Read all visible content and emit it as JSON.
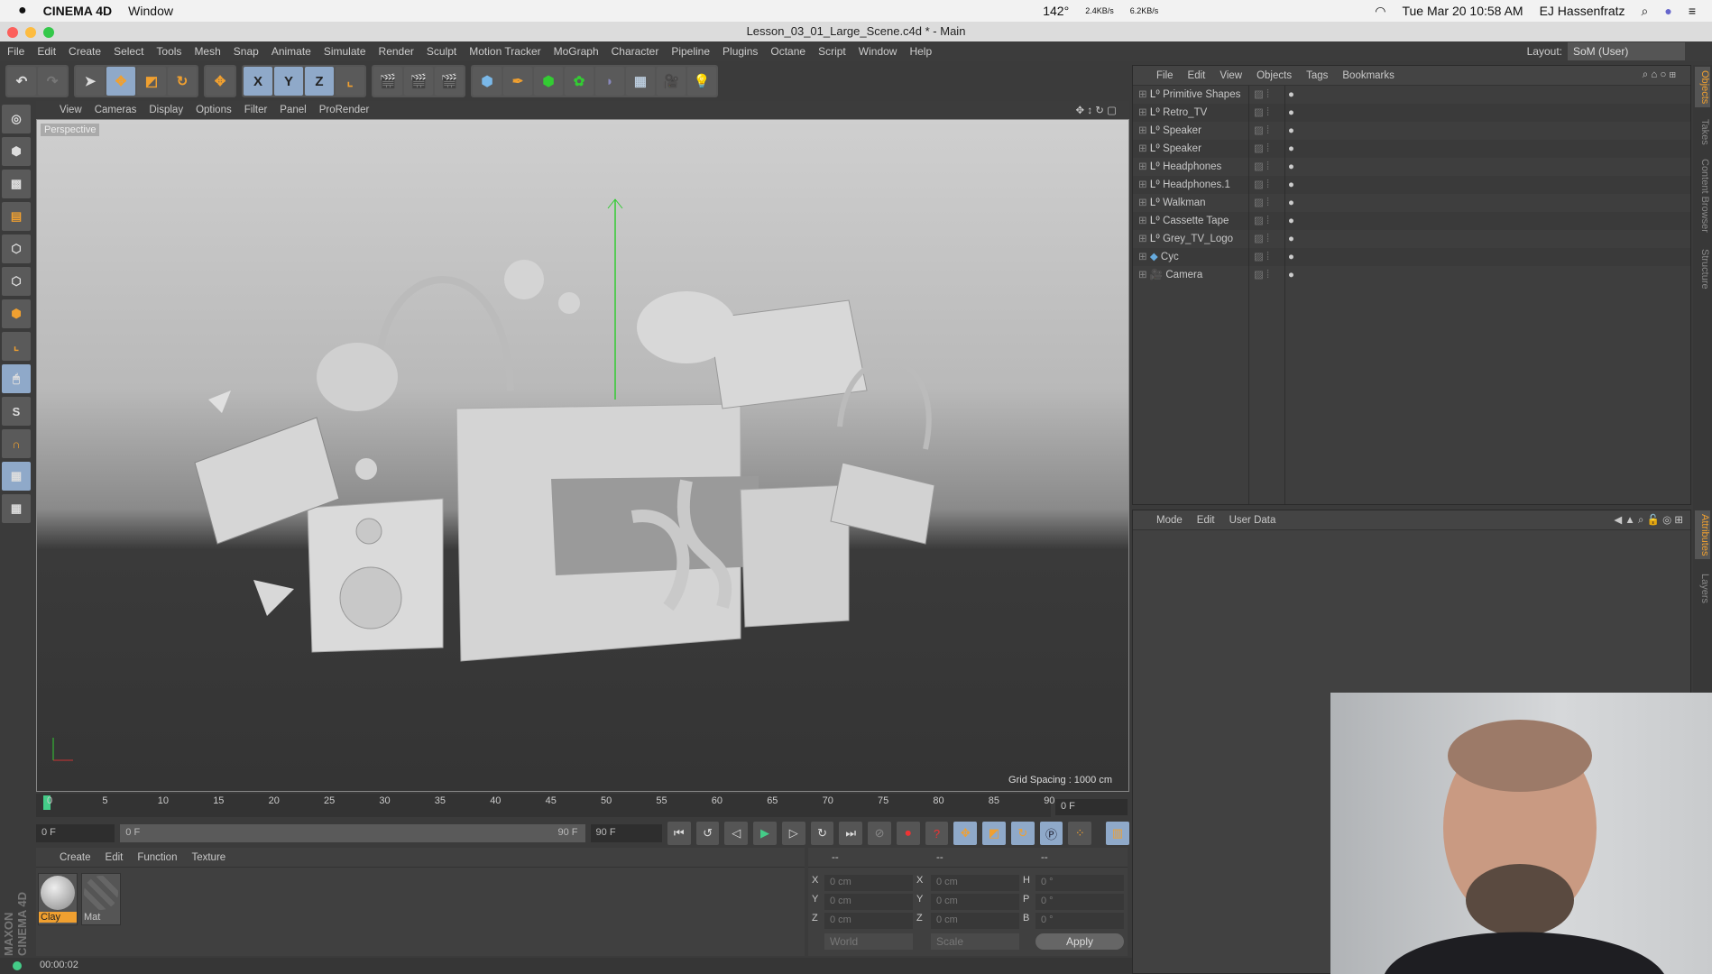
{
  "mac_menubar": {
    "app": "CINEMA 4D",
    "menu": "Window",
    "temp": "142°",
    "net_up": "2.4KB/s",
    "net_down": "6.2KB/s",
    "datetime": "Tue Mar 20  10:58 AM",
    "user": "EJ Hassenfratz"
  },
  "window": {
    "title": "Lesson_03_01_Large_Scene.c4d * - Main"
  },
  "menu": [
    "File",
    "Edit",
    "Create",
    "Select",
    "Tools",
    "Mesh",
    "Snap",
    "Animate",
    "Simulate",
    "Render",
    "Sculpt",
    "Motion Tracker",
    "MoGraph",
    "Character",
    "Pipeline",
    "Plugins",
    "Octane",
    "Script",
    "Window",
    "Help"
  ],
  "layout": {
    "label": "Layout:",
    "value": "SoM (User)"
  },
  "toolbar": {
    "x": "X",
    "y": "Y",
    "z": "Z"
  },
  "viewport": {
    "menu": [
      "View",
      "Cameras",
      "Display",
      "Options",
      "Filter",
      "Panel",
      "ProRender"
    ],
    "label": "Perspective",
    "grid_spacing": "Grid Spacing : 1000 cm"
  },
  "timeline": {
    "ticks": [
      "0",
      "5",
      "10",
      "15",
      "20",
      "25",
      "30",
      "35",
      "40",
      "45",
      "50",
      "55",
      "60",
      "65",
      "70",
      "75",
      "80",
      "85",
      "90"
    ],
    "current_frame": "0 F",
    "start": "0 F",
    "range_start": "0 F",
    "range_end": "90 F",
    "end": "90 F"
  },
  "material_manager": {
    "menu": [
      "Create",
      "Edit",
      "Function",
      "Texture"
    ],
    "materials": [
      {
        "name": "Clay",
        "selected": true
      },
      {
        "name": "Mat",
        "selected": false
      }
    ]
  },
  "coordinates": {
    "headers": [
      "--",
      "--",
      "--"
    ],
    "rows": [
      {
        "a": "X",
        "av": "0 cm",
        "b": "X",
        "bv": "0 cm",
        "c": "H",
        "cv": "0 °"
      },
      {
        "a": "Y",
        "av": "0 cm",
        "b": "Y",
        "bv": "0 cm",
        "c": "P",
        "cv": "0 °"
      },
      {
        "a": "Z",
        "av": "0 cm",
        "b": "Z",
        "bv": "0 cm",
        "c": "B",
        "cv": "0 °"
      }
    ],
    "mode": "World",
    "size_mode": "Scale",
    "apply": "Apply"
  },
  "status": {
    "time": "00:00:02"
  },
  "branding": "MAXON CINEMA 4D",
  "object_manager": {
    "menu": [
      "File",
      "Edit",
      "View",
      "Objects",
      "Tags",
      "Bookmarks"
    ],
    "objects": [
      {
        "name": "Primitive Shapes",
        "icon": "null-icon"
      },
      {
        "name": "Retro_TV",
        "icon": "null-icon"
      },
      {
        "name": "Speaker",
        "icon": "null-icon"
      },
      {
        "name": "Speaker",
        "icon": "null-icon"
      },
      {
        "name": "Headphones",
        "icon": "null-icon"
      },
      {
        "name": "Headphones.1",
        "icon": "null-icon"
      },
      {
        "name": "Walkman",
        "icon": "null-icon"
      },
      {
        "name": "Cassette Tape",
        "icon": "null-icon"
      },
      {
        "name": "Grey_TV_Logo",
        "icon": "null-icon"
      },
      {
        "name": "Cyc",
        "icon": "cyc-icon"
      },
      {
        "name": "Camera",
        "icon": "camera-icon"
      }
    ]
  },
  "attributes": {
    "menu": [
      "Mode",
      "Edit",
      "User Data"
    ]
  },
  "right_tabs": [
    "Objects",
    "Takes",
    "Content Browser",
    "Structure",
    "Attributes",
    "Layers"
  ],
  "colors": {
    "accent": "#f0a030",
    "selection": "#8fa9c9"
  }
}
